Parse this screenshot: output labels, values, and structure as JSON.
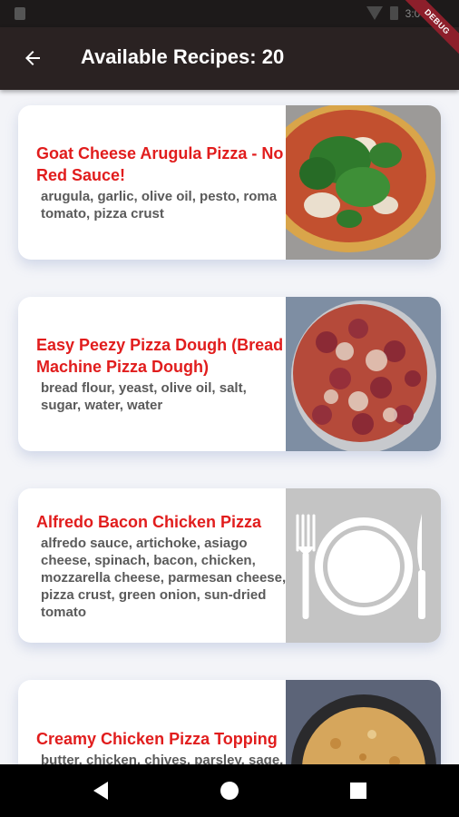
{
  "status_bar": {
    "time": "3:04"
  },
  "app_bar": {
    "title": "Available Recipes: 20",
    "debug_banner": "DEBUG"
  },
  "recipes": [
    {
      "title": "Goat Cheese Arugula Pizza - No Red Sauce!",
      "ingredients": "arugula, garlic, olive oil, pesto, roma tomato, pizza crust",
      "image": "pizza-arugula-photo"
    },
    {
      "title": "Easy Peezy Pizza Dough (Bread Machine Pizza Dough)",
      "ingredients": "bread flour, yeast, olive oil, salt, sugar, water, water",
      "image": "pizza-pepperoni-photo"
    },
    {
      "title": "Alfredo Bacon Chicken Pizza",
      "ingredients": "alfredo sauce, artichoke, asiago cheese, spinach, bacon, chicken, mozzarella cheese, parmesan cheese, pizza crust, green onion, sun-dried tomato",
      "image": "plate-fork-knife-placeholder-icon"
    },
    {
      "title": "Creamy Chicken Pizza Topping",
      "ingredients": "butter, chicken, chives, parsley, sage, flour, garlic, milk",
      "image": "pizza-pan-photo"
    }
  ],
  "nav": {
    "back": "back-triangle-icon",
    "home": "home-circle-icon",
    "recents": "recents-square-icon"
  }
}
